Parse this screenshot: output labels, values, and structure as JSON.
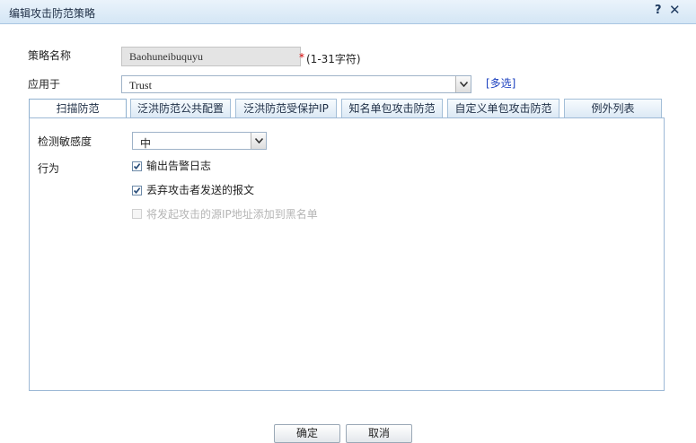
{
  "dialog": {
    "title": "编辑攻击防范策略",
    "help_label": "?",
    "close_label": "✕"
  },
  "form": {
    "name_label": "策略名称",
    "name_value": "Baohuneibuquyu",
    "required_mark": "*",
    "name_hint": "(1-31字符)",
    "apply_label": "应用于",
    "apply_value": "Trust",
    "multi_select_link": "[多选]"
  },
  "tabs": [
    {
      "label": "扫描防范",
      "active": true
    },
    {
      "label": "泛洪防范公共配置",
      "active": false
    },
    {
      "label": "泛洪防范受保护IP",
      "active": false
    },
    {
      "label": "知名单包攻击防范",
      "active": false
    },
    {
      "label": "自定义单包攻击防范",
      "active": false
    },
    {
      "label": "例外列表",
      "active": false
    }
  ],
  "scan_panel": {
    "sensitivity_label": "检测敏感度",
    "sensitivity_value": "中",
    "action_label": "行为",
    "options": [
      {
        "label": "输出告警日志",
        "checked": true,
        "enabled": true
      },
      {
        "label": "丢弃攻击者发送的报文",
        "checked": true,
        "enabled": true
      },
      {
        "label": "将发起攻击的源IP地址添加到黑名单",
        "checked": false,
        "enabled": false
      }
    ]
  },
  "buttons": {
    "ok_label": "确定",
    "cancel_label": "取消"
  },
  "colors": {
    "accent": "#1a3fbf",
    "required": "#d60000",
    "titlebar": "#dbeaf7"
  }
}
